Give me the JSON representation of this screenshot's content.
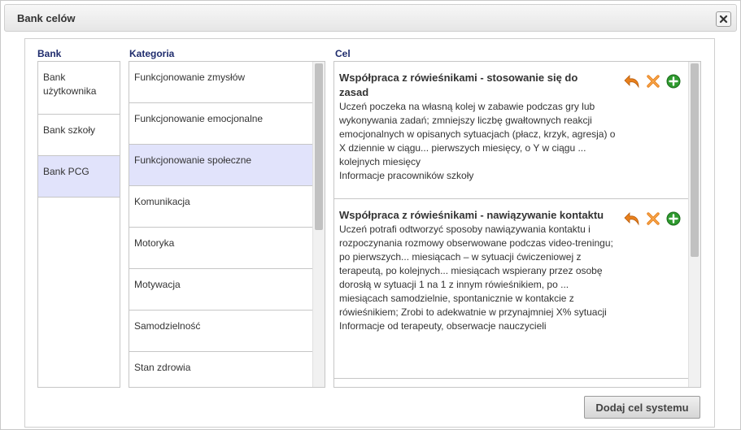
{
  "dialog": {
    "title": "Bank celów",
    "close_icon": "close-icon"
  },
  "columns": {
    "bank_label": "Bank",
    "category_label": "Kategoria",
    "goal_label": "Cel"
  },
  "banks": [
    {
      "label": "Bank użytkownika",
      "selected": false
    },
    {
      "label": "Bank szkoły",
      "selected": false
    },
    {
      "label": "Bank PCG",
      "selected": true
    }
  ],
  "categories": [
    {
      "label": "Funkcjonowanie zmysłów",
      "selected": false
    },
    {
      "label": "Funkcjonowanie emocjonalne",
      "selected": false
    },
    {
      "label": "Funkcjonowanie społeczne",
      "selected": true
    },
    {
      "label": "Komunikacja",
      "selected": false
    },
    {
      "label": "Motoryka",
      "selected": false
    },
    {
      "label": "Motywacja",
      "selected": false
    },
    {
      "label": "Samodzielność",
      "selected": false
    },
    {
      "label": "Stan zdrowia",
      "selected": false
    }
  ],
  "goals": [
    {
      "title": "Współpraca z rówieśnikami - stosowanie się do zasad",
      "description": "Uczeń poczeka na własną kolej w zabawie podczas gry lub wykonywania zadań; zmniejszy liczbę gwałtownych reakcji emocjonalnych w opisanych sytuacjach (płacz, krzyk, agresja) o X dziennie w ciągu... pierwszych miesięcy, o Y w ciągu ... kolejnych miesięcy",
      "source": "Informacje pracowników szkoły",
      "actions": [
        "undo-arrow-icon",
        "delete-x-icon",
        "add-plus-icon"
      ]
    },
    {
      "title": "Współpraca z rówieśnikami - nawiązywanie kontaktu",
      "description": "Uczeń potrafi odtworzyć sposoby nawiązywania kontaktu i rozpoczynania rozmowy obserwowane podczas video-treningu; po pierwszych... miesiącach – w sytuacji ćwiczeniowej z terapeutą, po kolejnych... miesiącach wspierany przez osobę dorosłą w sytuacji 1 na 1 z innym rówieśnikiem, po ... miesiącach samodzielnie, spontanicznie w kontakcie z rówieśnikiem; Zrobi to adekwatnie w przynajmniej X% sytuacji",
      "source": "Informacje od terapeuty, obserwacje nauczycieli",
      "actions": [
        "undo-arrow-icon",
        "delete-x-icon",
        "add-plus-icon"
      ]
    }
  ],
  "buttons": {
    "add_system_goal": "Dodaj cel systemu"
  },
  "colors": {
    "selected_bg": "#e1e3fb",
    "label_color": "#1f2c6d",
    "action_orange": "#e8801c",
    "action_green": "#2e9a2e"
  }
}
